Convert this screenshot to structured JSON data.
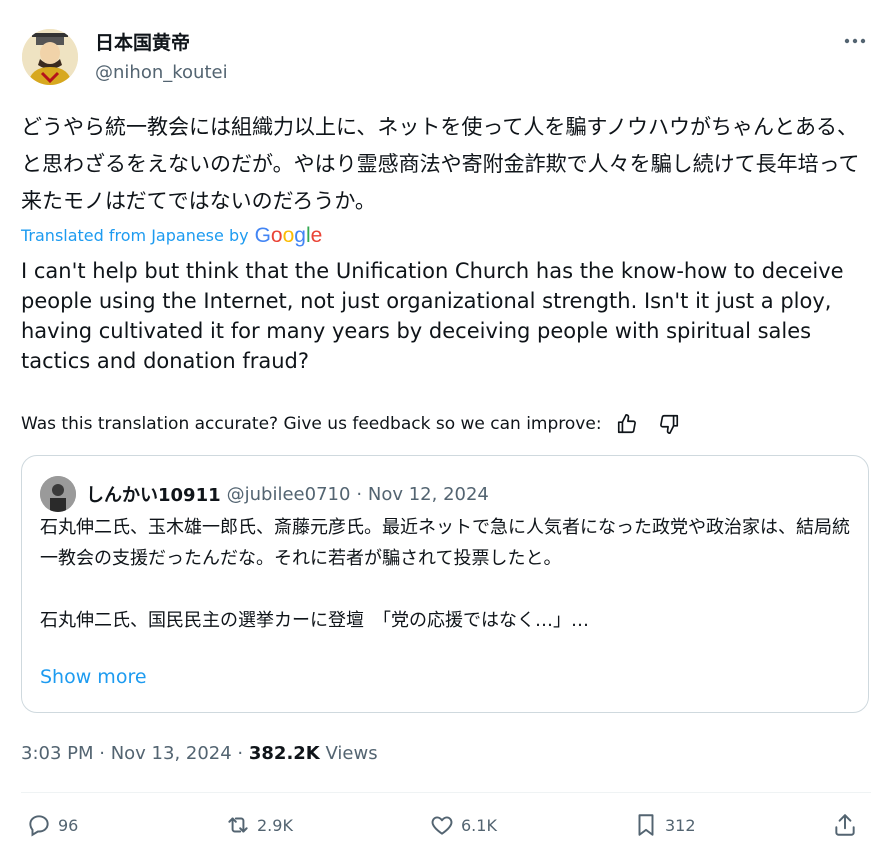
{
  "author": {
    "name": "日本国黄帝",
    "handle": "@nihon_koutei"
  },
  "tweet": {
    "text_ja": "どうやら統一教会には組織力以上に、ネットを使って人を騙すノウハウがちゃんとある、と思わざるをえないのだが。やはり霊感商法や寄附金詐欺で人々を騙し続けて長年培って来たモノはだてではないのだろうか。",
    "translated_label": "Translated from Japanese by",
    "translation_en": "I can't help but think that the Unification Church has the know-how to deceive people using the Internet, not just organizational strength. Isn't it just a ploy, having cultivated it for many years by deceiving people with spiritual sales tactics and donation fraud?",
    "feedback_prompt": "Was this translation accurate? Give us feedback so we can improve:"
  },
  "quote": {
    "name": "しんかい10911",
    "handle": "@jubilee0710",
    "date": "· Nov 12, 2024",
    "text": "石丸伸二氏、玉木雄一郎氏、斎藤元彦氏。最近ネットで急に人気者になった政党や政治家は、結局統一教会の支援だったんだな。それに若者が騙されて投票したと。\n\n石丸伸二氏、国民民主の選挙カーに登壇　「党の応援ではなく…」…",
    "show_more": "Show more"
  },
  "meta": {
    "time": "3:03 PM · Nov 13, 2024 · ",
    "views_count": "382.2K",
    "views_label": " Views"
  },
  "actions": {
    "replies": "96",
    "reposts": "2.9K",
    "likes": "6.1K",
    "bookmarks": "312"
  },
  "icons": [
    "more-icon",
    "thumbs-up-icon",
    "thumbs-down-icon",
    "reply-icon",
    "repost-icon",
    "like-icon",
    "bookmark-icon",
    "share-icon"
  ],
  "colors": {
    "link": "#1d9bf0",
    "secondary": "#536471",
    "text": "#0f1419",
    "border": "#cfd9de"
  }
}
